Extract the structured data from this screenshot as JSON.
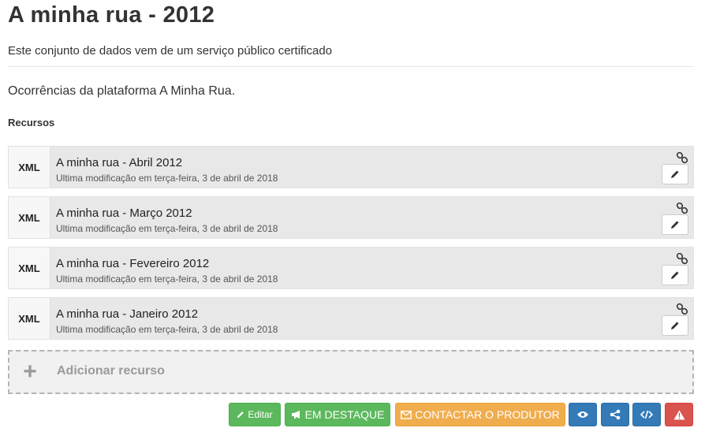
{
  "page": {
    "title": "A minha rua - 2012",
    "subtitle": "Este conjunto de dados vem de um serviço público certificado",
    "description": "Ocorrências da plataforma A Minha Rua.",
    "resources_heading": "Recursos"
  },
  "resources": [
    {
      "format": "XML",
      "name": "A minha rua - Abril 2012",
      "meta": "Ultima modificação em terça-feira, 3 de abril de 2018"
    },
    {
      "format": "XML",
      "name": "A minha rua - Março 2012",
      "meta": "Ultima modificação em terça-feira, 3 de abril de 2018"
    },
    {
      "format": "XML",
      "name": "A minha rua - Fevereiro 2012",
      "meta": "Ultima modificação em terça-feira, 3 de abril de 2018"
    },
    {
      "format": "XML",
      "name": "A minha rua - Janeiro 2012",
      "meta": "Ultima modificação em terça-feira, 3 de abril de 2018"
    }
  ],
  "add_resource": {
    "icon": "plus-icon",
    "label": "Adicionar recurso"
  },
  "actions": {
    "edit_label": "Editar",
    "highlight_label": "EM DESTAQUE",
    "contact_label": "CONTACTAR O PRODUTOR",
    "icons": [
      "pencil-icon",
      "bullhorn-icon",
      "envelope-icon",
      "eye-icon",
      "share-icon",
      "code-icon",
      "warning-icon"
    ]
  },
  "colors": {
    "green": "#5cb85c",
    "orange": "#f0ad4e",
    "blue": "#337ab7",
    "red": "#d9534f"
  }
}
